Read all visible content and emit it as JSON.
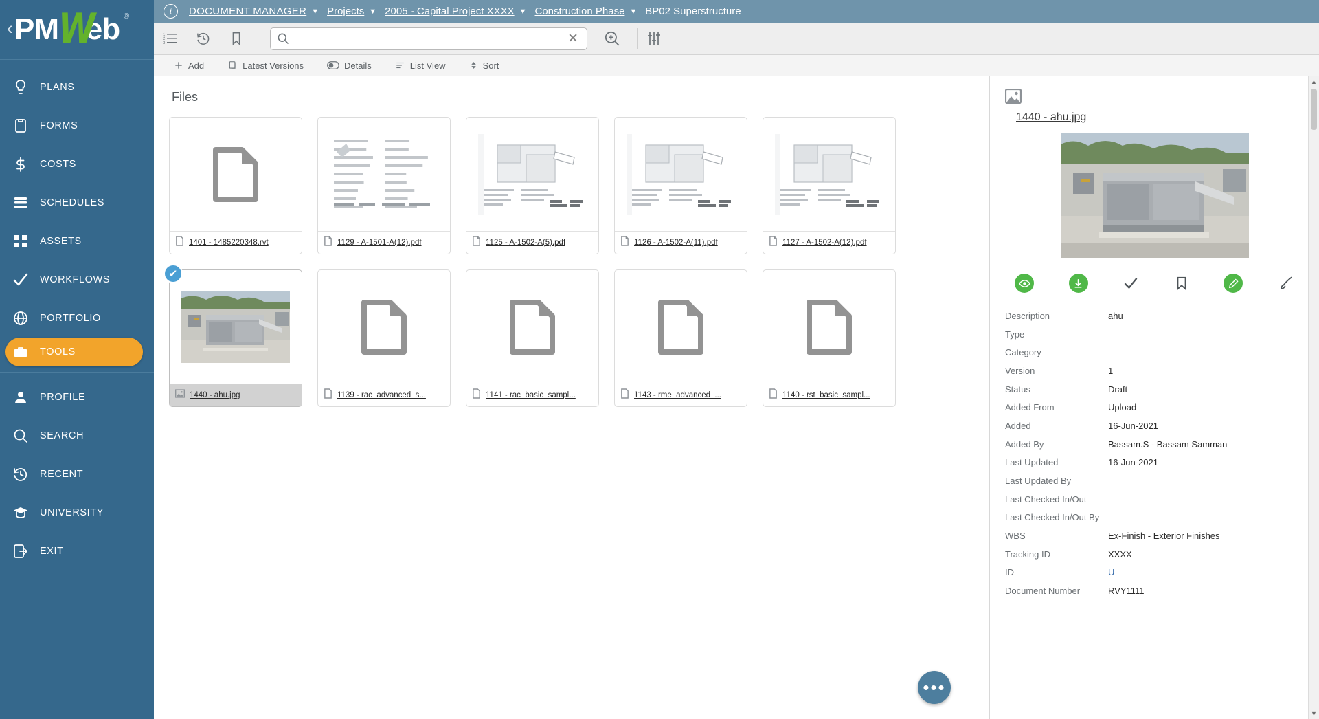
{
  "brand": {
    "name_pm": "PM",
    "name_w": "W",
    "name_eb": "eb",
    "registered": "®",
    "collapse": "‹"
  },
  "sidebar": {
    "items": [
      {
        "label": "PLANS",
        "icon": "lightbulb-icon",
        "active": false
      },
      {
        "label": "FORMS",
        "icon": "clipboard-icon",
        "active": false
      },
      {
        "label": "COSTS",
        "icon": "dollar-icon",
        "active": false
      },
      {
        "label": "SCHEDULES",
        "icon": "calendar-icon",
        "active": false
      },
      {
        "label": "ASSETS",
        "icon": "grid-icon",
        "active": false
      },
      {
        "label": "WORKFLOWS",
        "icon": "check-icon",
        "active": false
      },
      {
        "label": "PORTFOLIO",
        "icon": "globe-icon",
        "active": false
      },
      {
        "label": "TOOLS",
        "icon": "toolbox-icon",
        "active": true
      },
      {
        "label": "PROFILE",
        "icon": "user-icon",
        "active": false
      },
      {
        "label": "SEARCH",
        "icon": "search-icon",
        "active": false
      },
      {
        "label": "RECENT",
        "icon": "history-icon",
        "active": false
      },
      {
        "label": "UNIVERSITY",
        "icon": "graduation-cap-icon",
        "active": false
      },
      {
        "label": "EXIT",
        "icon": "exit-icon",
        "active": false
      }
    ]
  },
  "topbar": {
    "info_icon": "info-icon",
    "breadcrumbs": [
      {
        "label": "DOCUMENT MANAGER",
        "caret": true
      },
      {
        "label": "Projects",
        "caret": true
      },
      {
        "label": "2005 - Capital Project XXXX",
        "caret": true
      },
      {
        "label": "Construction Phase",
        "caret": true
      },
      {
        "label": "BP02 Superstructure",
        "caret": false
      }
    ]
  },
  "toolbar": {
    "buttons": [
      {
        "name": "numbered-list-icon"
      },
      {
        "name": "history-icon"
      },
      {
        "name": "bookmark-icon"
      }
    ],
    "search": {
      "value": "",
      "placeholder": "",
      "clear": "✕"
    },
    "zoom_search_icon": "zoom-search-icon",
    "filter_icon": "filter-sliders-icon"
  },
  "actionbar": {
    "items": [
      {
        "label": "Add",
        "icon": "plus-icon"
      },
      {
        "label": "Latest Versions",
        "icon": "versions-icon"
      },
      {
        "label": "Details",
        "icon": "toggle-icon"
      },
      {
        "label": "List View",
        "icon": "list-icon"
      },
      {
        "label": "Sort",
        "icon": "sort-icon"
      }
    ]
  },
  "files": {
    "title": "Files",
    "fab_label": "•••",
    "tiles": [
      {
        "name": "1401 - 1485220348.rvt",
        "icon": "file-icon",
        "thumb": "blank-doc",
        "selected": false
      },
      {
        "name": "1129 - A-1501-A(12).pdf",
        "icon": "pdf-icon",
        "thumb": "drawing",
        "selected": false
      },
      {
        "name": "1125 - A-1502-A(5).pdf",
        "icon": "pdf-icon",
        "thumb": "floorplan",
        "selected": false
      },
      {
        "name": "1126 - A-1502-A(11).pdf",
        "icon": "pdf-icon",
        "thumb": "floorplan",
        "selected": false
      },
      {
        "name": "1127 - A-1502-A(12).pdf",
        "icon": "pdf-icon",
        "thumb": "floorplan",
        "selected": false
      },
      {
        "name": "1440 - ahu.jpg",
        "icon": "image-icon",
        "thumb": "photo",
        "selected": true
      },
      {
        "name": "1139 - rac_advanced_s...",
        "icon": "file-icon",
        "thumb": "blank-doc",
        "selected": false
      },
      {
        "name": "1141 - rac_basic_sampl...",
        "icon": "file-icon",
        "thumb": "blank-doc",
        "selected": false
      },
      {
        "name": "1143 - rme_advanced_...",
        "icon": "file-icon",
        "thumb": "blank-doc",
        "selected": false
      },
      {
        "name": "1140 - rst_basic_sampl...",
        "icon": "file-icon",
        "thumb": "blank-doc",
        "selected": false
      }
    ]
  },
  "details": {
    "header_icon": "image-icon",
    "title": "1440 - ahu.jpg",
    "preview_alt": "rooftop-air-handling-unit-photo",
    "actions": [
      {
        "name": "view-icon",
        "style": "green-circle",
        "glyph": "◉"
      },
      {
        "name": "download-icon",
        "style": "green-circle",
        "glyph": "↓"
      },
      {
        "name": "approve-check-icon",
        "style": "plain",
        "glyph": "✔"
      },
      {
        "name": "bookmark-icon",
        "style": "plain",
        "glyph": "⌂"
      },
      {
        "name": "edit-icon",
        "style": "green-circle",
        "glyph": "✎"
      },
      {
        "name": "markup-brush-icon",
        "style": "plain",
        "glyph": "✒"
      }
    ],
    "fields": [
      {
        "key": "Description",
        "value": "ahu",
        "link": false
      },
      {
        "key": "Type",
        "value": "",
        "link": false
      },
      {
        "key": "Category",
        "value": "",
        "link": false
      },
      {
        "key": "Version",
        "value": "1",
        "link": false
      },
      {
        "key": "Status",
        "value": "Draft",
        "link": false
      },
      {
        "key": "Added From",
        "value": "Upload",
        "link": false
      },
      {
        "key": "Added",
        "value": "16-Jun-2021",
        "link": false
      },
      {
        "key": "Added By",
        "value": "Bassam.S - Bassam Samman",
        "link": false
      },
      {
        "key": "Last Updated",
        "value": "16-Jun-2021",
        "link": false
      },
      {
        "key": "Last Updated By",
        "value": "",
        "link": false
      },
      {
        "key": "Last Checked In/Out",
        "value": "",
        "link": false
      },
      {
        "key": "Last Checked In/Out By",
        "value": "",
        "link": false
      },
      {
        "key": "WBS",
        "value": "Ex-Finish - Exterior Finishes",
        "link": false
      },
      {
        "key": "Tracking ID",
        "value": "XXXX",
        "link": false
      },
      {
        "key": "ID",
        "value": "U",
        "link": true
      },
      {
        "key": "Document Number",
        "value": "RVY1111",
        "link": false
      }
    ],
    "scroll_up": "▲",
    "scroll_down": "▼"
  },
  "colors": {
    "sidebar": "#35688c",
    "accent_orange": "#f2a42b",
    "brand_green": "#63b22c",
    "topbar": "#6f94ab",
    "select_blue": "#4a9fd4",
    "action_green": "#50b848"
  }
}
